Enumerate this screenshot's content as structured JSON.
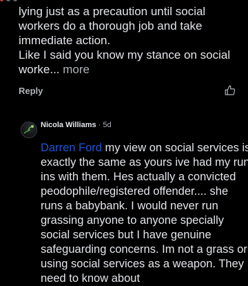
{
  "colors": {
    "background": "#000000",
    "text_primary": "#e4e6eb",
    "text_secondary": "#b0b3b8",
    "mention": "#1d55d6"
  },
  "comment": {
    "text_lines": "lying just as a precaution until social\nworkers do a thorough job and take\nimmediate action.\nLike I said you know my stance on social\nworke...",
    "more_label": "more",
    "reply_label": "Reply",
    "like_icon": "thumbs-up-icon"
  },
  "reply": {
    "author": "Nicola Williams",
    "separator": " · ",
    "time": "5d",
    "mention": "Darren Ford",
    "text": " my view on social services is exactly the same as yours ive had my run ins with them. Hes actually a convicted peodophile/registered offender.... she runs a babybank. I would never run grassing anyone to anyone specially social services but I have genuine safeguarding concerns. Im not a grass or using social services as a weapon. They need to know about"
  }
}
